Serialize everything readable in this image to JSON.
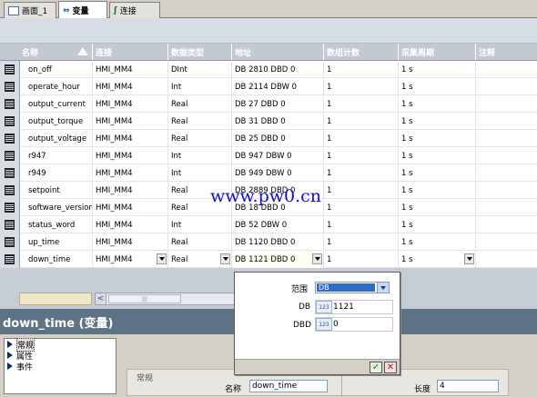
{
  "tabs": [
    {
      "label": "画面_1",
      "icon": "screen-icon"
    },
    {
      "label": "变量",
      "icon": "variable-icon"
    },
    {
      "label": "连接",
      "icon": "connection-icon"
    }
  ],
  "columns": {
    "name": "名称",
    "connection": "连接",
    "datatype": "数据类型",
    "address": "地址",
    "array_count": "数组计数",
    "cycle": "采集周期",
    "comment": "注释"
  },
  "rows": [
    {
      "name": "on_off",
      "connection": "HMI_MM4",
      "datatype": "DInt",
      "address": "DB 2810 DBD 0",
      "array_count": "1",
      "cycle": "1 s"
    },
    {
      "name": "operate_hour",
      "connection": "HMI_MM4",
      "datatype": "Int",
      "address": "DB 2114 DBW 0",
      "array_count": "1",
      "cycle": "1 s"
    },
    {
      "name": "output_current",
      "connection": "HMI_MM4",
      "datatype": "Real",
      "address": "DB 27 DBD 0",
      "array_count": "1",
      "cycle": "1 s"
    },
    {
      "name": "output_torque",
      "connection": "HMI_MM4",
      "datatype": "Real",
      "address": "DB 31 DBD 0",
      "array_count": "1",
      "cycle": "1 s"
    },
    {
      "name": "output_voltage",
      "connection": "HMI_MM4",
      "datatype": "Real",
      "address": "DB 25 DBD 0",
      "array_count": "1",
      "cycle": "1 s"
    },
    {
      "name": "r947",
      "connection": "HMI_MM4",
      "datatype": "Int",
      "address": "DB 947 DBW 0",
      "array_count": "1",
      "cycle": "1 s"
    },
    {
      "name": "r949",
      "connection": "HMI_MM4",
      "datatype": "Int",
      "address": "DB 949 DBW 0",
      "array_count": "1",
      "cycle": "1 s"
    },
    {
      "name": "setpoint",
      "connection": "HMI_MM4",
      "datatype": "Real",
      "address": "DB 2889 DBD 0",
      "array_count": "1",
      "cycle": "1 s"
    },
    {
      "name": "software_version",
      "connection": "HMI_MM4",
      "datatype": "Real",
      "address": "DB 18 DBD 0",
      "array_count": "1",
      "cycle": "1 s"
    },
    {
      "name": "status_word",
      "connection": "HMI_MM4",
      "datatype": "Int",
      "address": "DB 52 DBW 0",
      "array_count": "1",
      "cycle": "1 s"
    },
    {
      "name": "up_time",
      "connection": "HMI_MM4",
      "datatype": "Real",
      "address": "DB 1120 DBD 0",
      "array_count": "1",
      "cycle": "1 s"
    },
    {
      "name": "down_time",
      "connection": "HMI_MM4",
      "datatype": "Real",
      "address": "DB 1121 DBD 0",
      "array_count": "1",
      "cycle": "1 s"
    }
  ],
  "popup": {
    "range_label": "范围",
    "range_value": "DB",
    "db_label": "DB",
    "db_value": "1121",
    "dbd_label": "DBD",
    "dbd_value": "0",
    "num_icon_text": "123",
    "ok_symbol": "✓",
    "cancel_symbol": "✕"
  },
  "watermark": "www.pw0.cn",
  "inspector": {
    "title": "down_time (变量)",
    "nav": [
      "常规",
      "属性",
      "事件"
    ],
    "group": "常规",
    "name_label": "名称",
    "name_value": "down_time",
    "length_label": "长度",
    "length_value": "4"
  },
  "scroll": {
    "left_arrow": "<",
    "thumb_grip": "|||"
  }
}
